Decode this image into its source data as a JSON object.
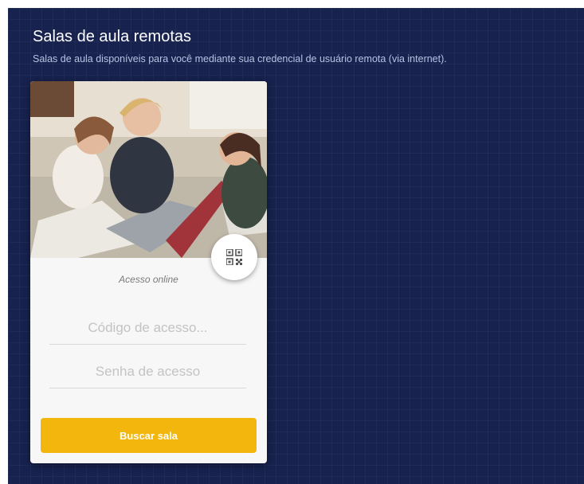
{
  "header": {
    "title": "Salas de aula remotas",
    "subtitle": "Salas de aula disponíveis para você mediante sua credencial de usuário remota (via internet)."
  },
  "card": {
    "online_label": "Acesso online",
    "code_field": {
      "placeholder": "Código de acesso...",
      "value": ""
    },
    "password_field": {
      "placeholder": "Senha de acesso",
      "value": ""
    },
    "search_button_label": "Buscar sala",
    "qr_icon": "qr-code-icon"
  },
  "colors": {
    "background": "#17224f",
    "card": "#f7f7f7",
    "accent": "#f3b60d"
  }
}
